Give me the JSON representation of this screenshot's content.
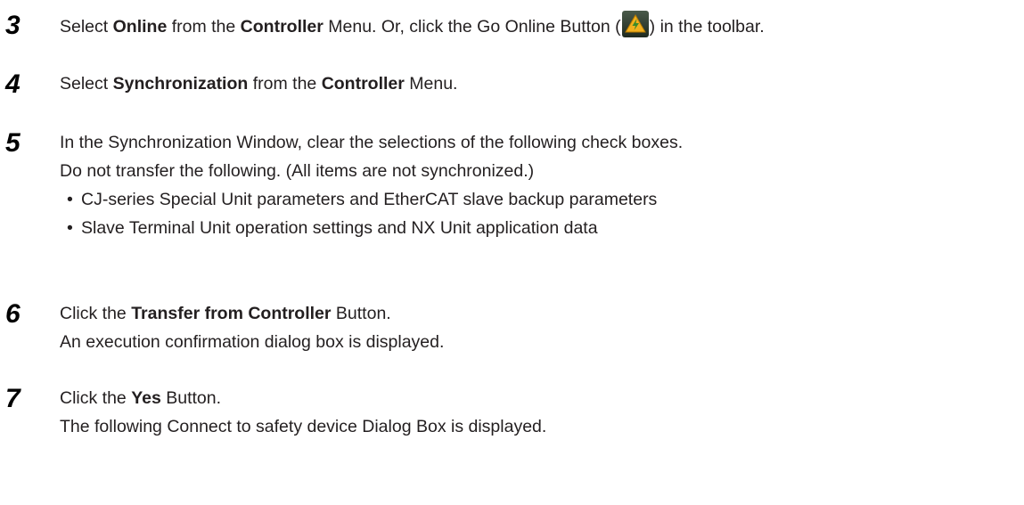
{
  "steps": [
    {
      "number": "3",
      "parts": [
        "Select ",
        "Online",
        " from the ",
        "Controller",
        " Menu. Or, click the Go Online Button (",
        ") in the toolbar."
      ],
      "icon": "go-online-icon"
    },
    {
      "number": "4",
      "parts": [
        "Select ",
        "Synchronization",
        " from the ",
        "Controller",
        " Menu."
      ]
    },
    {
      "number": "5",
      "lines": [
        "In the Synchronization Window, clear the selections of the following check boxes.",
        "Do not transfer the following. (All items are not synchronized.)"
      ],
      "bullet_char": "•",
      "bullets": [
        "CJ-series Special Unit parameters and EtherCAT slave backup parameters",
        "Slave Terminal Unit operation settings and NX Unit application data"
      ]
    },
    {
      "number": "6",
      "parts": [
        "Click the ",
        "Transfer from Controller",
        " Button."
      ],
      "line2": "An execution confirmation dialog box is displayed."
    },
    {
      "number": "7",
      "parts": [
        "Click the ",
        "Yes",
        " Button."
      ],
      "line2": "The following Connect to safety device Dialog Box is displayed."
    }
  ]
}
